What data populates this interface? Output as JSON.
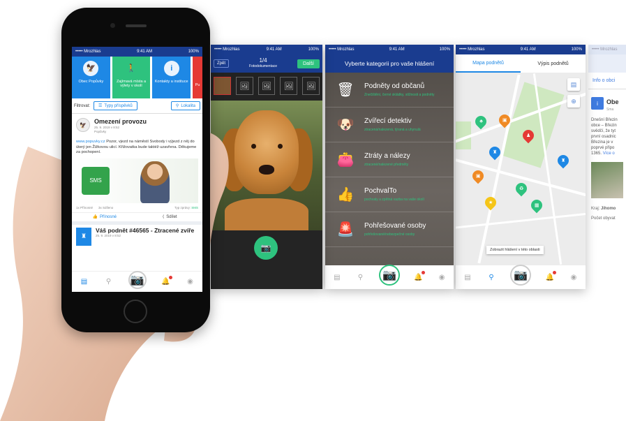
{
  "statusbar": {
    "carrier": "••••• Mrozhlas",
    "time": "9:41 AM",
    "battery": "100%"
  },
  "screen1": {
    "tiles": [
      {
        "label": "Obec Popůvky",
        "color": "#1e88e5",
        "icon": "badge-icon",
        "glyph": "🦅"
      },
      {
        "label": "Zajímavá místa a výlety v okolí",
        "color": "#2ec27e",
        "icon": "hiker-icon",
        "glyph": "🚶"
      },
      {
        "label": "Kontakty a instituce",
        "color": "#1e88e5",
        "icon": "info-icon",
        "glyph": "i"
      },
      {
        "label": "Pu",
        "color": "#e53935",
        "icon": "",
        "glyph": ""
      }
    ],
    "filter": {
      "label": "Filtrovat:",
      "types_button": "Typy příspěvků",
      "location_button": "Lokalita"
    },
    "post": {
      "title": "Omezení provozu",
      "date": "25. 9. 2019 v 8:52",
      "source": "Popůvky",
      "body_link": "www.popuvky.cz",
      "body": " Pozor, vjezd na náměstí Svobody i výjezd z něj do úterý jen Žižkovou ulicí. Křižovatka bude taktéž uzavřena. Děkujeme za pochopení.",
      "sms_label": "SMS",
      "likes": "1x Přínosné",
      "views": "3x Sdíleno",
      "type_label": "Typ zprávy:",
      "type_value": "SMS",
      "like_button": "Přínosné",
      "share_button": "Sdílet"
    },
    "post2": {
      "title": "Váš podnět #46565 - Ztracené zvíře",
      "date": "25. 9. 2019 v 8:52"
    }
  },
  "screen2": {
    "back": "Zpět",
    "counter": "1/4",
    "subtitle": "Fotodokumentace",
    "next": "Další"
  },
  "screen3": {
    "header": "Vyberte kategorii pro vaše hlášení",
    "categories": [
      {
        "title": "Podněty od občanů",
        "subtitle": "Znečištění, černé skládky, stížnosti a podněty",
        "icon": "trash-icon",
        "glyph": "🗑"
      },
      {
        "title": "Zvířecí detektiv",
        "subtitle": "ztracená/nalezená, týraná a uhynulá",
        "icon": "dog-icon",
        "glyph": "🐶"
      },
      {
        "title": "Ztráty a nálezy",
        "subtitle": "ztracené/nalezené předměty",
        "icon": "wallet-icon",
        "glyph": "👛"
      },
      {
        "title": "PochvalTo",
        "subtitle": "pochvaly a zpětná vazba na vaše okolí",
        "icon": "thumbs-up-icon",
        "glyph": "👍"
      },
      {
        "title": "Pohřešované osoby",
        "subtitle": "pohřešované/nebezpečné osoby",
        "icon": "siren-icon",
        "glyph": "🚨"
      }
    ]
  },
  "screen4": {
    "tab_map": "Mapa podnětů",
    "tab_list": "Výpis podnětů",
    "show_here": "Zobrazit hlášení v této oblasti"
  },
  "screen5": {
    "tab": "Info o obci",
    "name": "Obe",
    "sub": "Sma",
    "text": "Dnešní Březin obce – Březin svědčí, že tyt první osadnic Březina je v poprvé připo 1365.",
    "link": "Více o",
    "region": "Kraj:",
    "region_val": "Jihomo",
    "population": "Počet obyvat"
  },
  "colors": {
    "primary": "#1a3c8f",
    "accent": "#2ec27e",
    "blue": "#1e88e5"
  }
}
